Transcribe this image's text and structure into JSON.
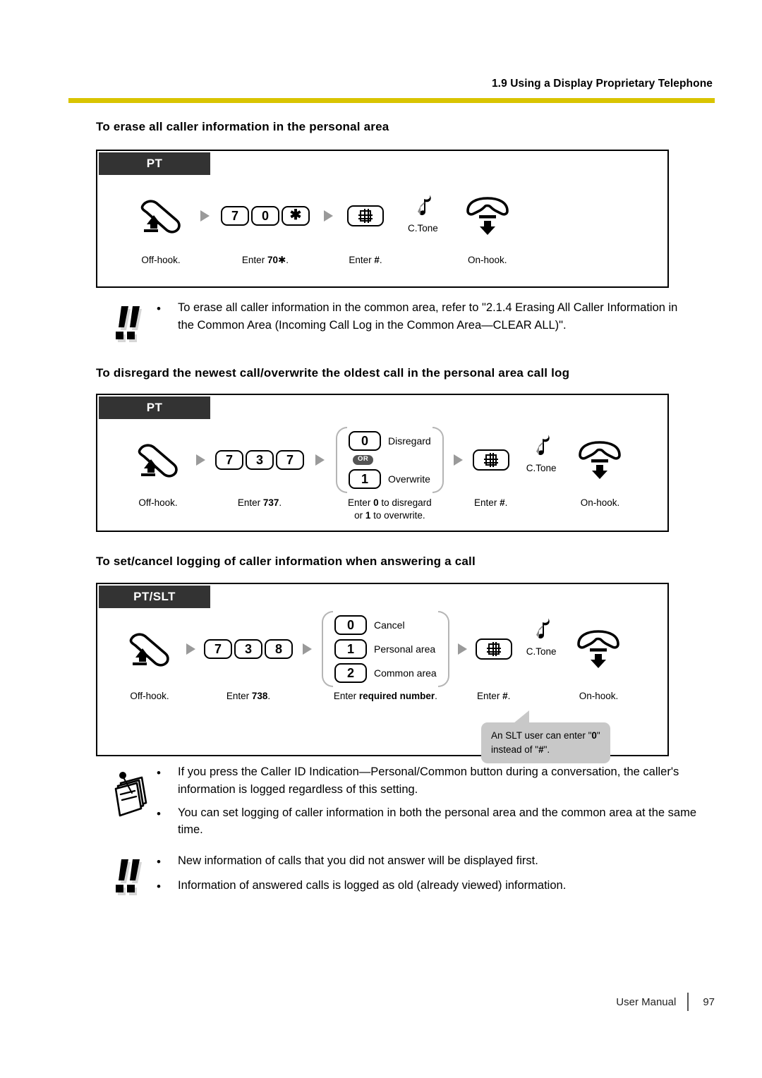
{
  "header": {
    "title": "1.9 Using a Display Proprietary Telephone",
    "rule_color": "#d9c400"
  },
  "sections": [
    {
      "heading": "To erase all caller information in the personal area",
      "tag": "PT",
      "steps": [
        {
          "type": "offhook",
          "icon": "handset-offhook-icon",
          "label": "Off-hook."
        },
        {
          "type": "keys",
          "keys": [
            "7",
            "0",
            "*"
          ],
          "label_prefix": "Enter ",
          "label_bold": "70",
          "label_suffix": "."
        },
        {
          "type": "hashkey",
          "icon": "hash-key-icon",
          "label_prefix": "Enter ",
          "label_bold": "#",
          "label_suffix": "."
        },
        {
          "type": "ctone",
          "icon": "music-note-icon",
          "label": "C.Tone"
        },
        {
          "type": "onhook",
          "icon": "handset-onhook-icon",
          "label": "On-hook."
        }
      ]
    },
    {
      "heading": "To disregard the newest call/overwrite the oldest call in the personal area call log",
      "tag": "PT",
      "steps": [
        {
          "type": "offhook",
          "icon": "handset-offhook-icon",
          "label": "Off-hook."
        },
        {
          "type": "keys",
          "keys": [
            "7",
            "3",
            "7"
          ],
          "label_prefix": "Enter ",
          "label_bold": "737",
          "label_suffix": "."
        },
        {
          "type": "options",
          "or_badge": "OR",
          "options": [
            {
              "key": "0",
              "text": "Disregard"
            },
            {
              "key": "1",
              "text": "Overwrite"
            }
          ],
          "label_line1_a": "Enter ",
          "label_line1_b": "0",
          "label_line1_c": " to disregard",
          "label_line2_a": "or ",
          "label_line2_b": "1",
          "label_line2_c": " to overwrite."
        },
        {
          "type": "hashkey",
          "icon": "hash-key-icon",
          "label_prefix": "Enter ",
          "label_bold": "#",
          "label_suffix": "."
        },
        {
          "type": "ctone",
          "icon": "music-note-icon",
          "label": "C.Tone"
        },
        {
          "type": "onhook",
          "icon": "handset-onhook-icon",
          "label": "On-hook."
        }
      ]
    },
    {
      "heading": "To set/cancel logging of caller information when answering a call",
      "tag": "PT/SLT",
      "steps": [
        {
          "type": "offhook",
          "icon": "handset-offhook-icon",
          "label": "Off-hook."
        },
        {
          "type": "keys",
          "keys": [
            "7",
            "3",
            "8"
          ],
          "label_prefix": "Enter ",
          "label_bold": "738",
          "label_suffix": "."
        },
        {
          "type": "options",
          "options": [
            {
              "key": "0",
              "text": "Cancel"
            },
            {
              "key": "1",
              "text": "Personal area"
            },
            {
              "key": "2",
              "text": "Common area"
            }
          ],
          "label_prefix": "Enter ",
          "label_bold": "required number",
          "label_suffix": "."
        },
        {
          "type": "hashkey",
          "icon": "hash-key-icon",
          "label_prefix": "Enter ",
          "label_bold": "#",
          "label_suffix": "."
        },
        {
          "type": "ctone",
          "icon": "music-note-icon",
          "label": "C.Tone"
        },
        {
          "type": "onhook",
          "icon": "handset-onhook-icon",
          "label": "On-hook."
        }
      ],
      "callout": {
        "line1_a": "An SLT user can enter \"",
        "line1_b": "0",
        "line1_c": "\"",
        "line2_a": "instead of \"",
        "line2_b": "#",
        "line2_c": "\"."
      }
    }
  ],
  "notes": [
    {
      "icon": "caution-double-exclamation-icon",
      "items": [
        "To erase all caller information in the common area, refer to \"2.1.4 Erasing All Caller Information in the Common Area (Incoming Call Log in the Common Area—CLEAR ALL)\"."
      ]
    },
    {
      "icon": "notepad-icon",
      "items": [
        "If you press the Caller ID Indication—Personal/Common button during a conversation, the caller's information is logged regardless of this setting.",
        "You can set logging of caller information in both the personal area and the common area at the same time."
      ]
    },
    {
      "icon": "caution-double-exclamation-icon",
      "items": [
        "New information of calls that you did not answer will be displayed first.",
        "Information of answered calls is logged as old (already viewed) information."
      ]
    }
  ],
  "footer": {
    "label": "User Manual",
    "page": "97"
  }
}
